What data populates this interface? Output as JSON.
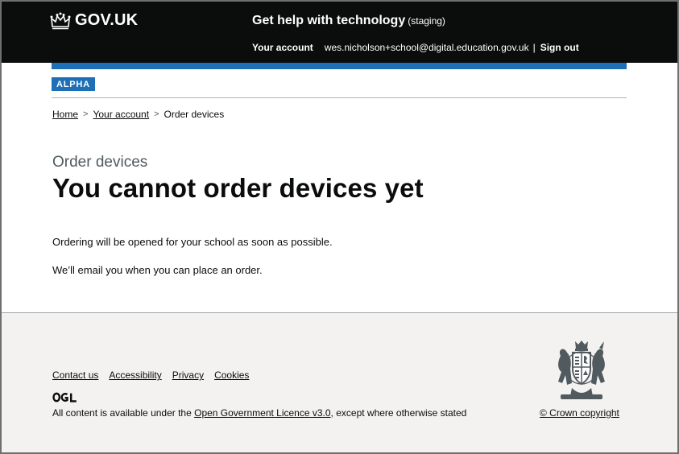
{
  "header": {
    "logo_text": "GOV.UK",
    "service_name": "Get help with technology",
    "environment": "(staging)",
    "nav": {
      "account_label": "Your account",
      "email": "wes.nicholson+school@digital.education.gov.uk",
      "separator": "|",
      "sign_out_label": "Sign out"
    }
  },
  "phase_banner": {
    "tag": "ALPHA"
  },
  "breadcrumbs": {
    "items": [
      "Home",
      "Your account",
      "Order devices"
    ],
    "separator": ">"
  },
  "main": {
    "caption": "Order devices",
    "heading": "You cannot order devices yet",
    "paragraphs": [
      "Ordering will be opened for your school as soon as possible.",
      "We’ll email you when you can place an order."
    ]
  },
  "footer": {
    "links": [
      "Contact us",
      "Accessibility",
      "Privacy",
      "Cookies"
    ],
    "ogl_logo_text": "OGL",
    "licence_prefix": "All content is available under the ",
    "licence_link": "Open Government Licence v3.0",
    "licence_suffix": ", except where otherwise stated",
    "copyright": "© Crown copyright"
  },
  "colors": {
    "header_background": "#0b0c0c",
    "brand_blue": "#1d70b8",
    "footer_background": "#f3f2f1",
    "text": "#0b0c0c",
    "secondary_text": "#505a5f"
  },
  "icons": {
    "logo": "crown-icon",
    "ogl": "ogl-logo-icon",
    "crest": "royal-coat-of-arms-icon"
  }
}
